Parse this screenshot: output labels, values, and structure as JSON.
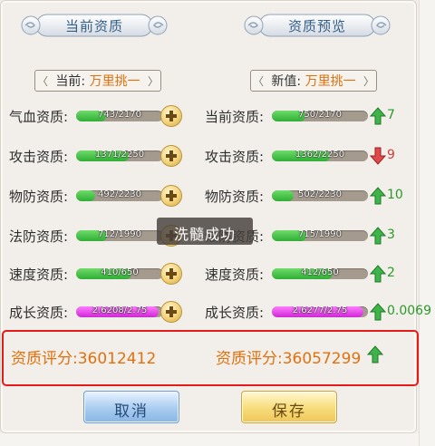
{
  "header": {
    "left_title": "当前资质",
    "right_title": "资质预览"
  },
  "current": {
    "prefix": "当前:",
    "name": "万里挑一"
  },
  "preview": {
    "prefix": "新值:",
    "name": "万里挑一"
  },
  "rows": [
    {
      "label": "气血资质:",
      "cur_text": "743/2170",
      "cur_ratio": 0.342,
      "new_label": "当前资质:",
      "new_text": "750/2170",
      "new_ratio": 0.346,
      "delta": "7",
      "dir": "up"
    },
    {
      "label": "攻击资质:",
      "cur_text": "1371/2250",
      "cur_ratio": 0.609,
      "new_label": "攻击资质:",
      "new_text": "1362/2250",
      "new_ratio": 0.605,
      "delta": "9",
      "dir": "down"
    },
    {
      "label": "物防资质:",
      "cur_text": "492/2230",
      "cur_ratio": 0.221,
      "new_label": "物防资质:",
      "new_text": "502/2230",
      "new_ratio": 0.225,
      "delta": "10",
      "dir": "up"
    },
    {
      "label": "法防资质:",
      "cur_text": "712/1990",
      "cur_ratio": 0.358,
      "new_label": "法防资质:",
      "new_text": "715/1990",
      "new_ratio": 0.359,
      "delta": "3",
      "dir": "up"
    },
    {
      "label": "速度资质:",
      "cur_text": "410/650",
      "cur_ratio": 0.631,
      "new_label": "速度资质:",
      "new_text": "412/650",
      "new_ratio": 0.634,
      "delta": "2",
      "dir": "up"
    },
    {
      "label": "成长资质:",
      "cur_text": "2.6208/2.75",
      "cur_ratio": 0.953,
      "new_label": "成长资质:",
      "new_text": "2.6277/2.75",
      "new_ratio": 0.956,
      "delta": "0.0069",
      "dir": "up",
      "growth": true
    }
  ],
  "toast": "洗髓成功",
  "score": {
    "current": "资质评分:36012412",
    "preview": "资质评分:36057299",
    "dir": "up"
  },
  "buttons": {
    "cancel": "取消",
    "save": "保存"
  },
  "colors": {
    "up": "#2a9a2a",
    "down": "#d43c3c",
    "highlight": "#e0710e",
    "score_border": "#e71a1a"
  }
}
